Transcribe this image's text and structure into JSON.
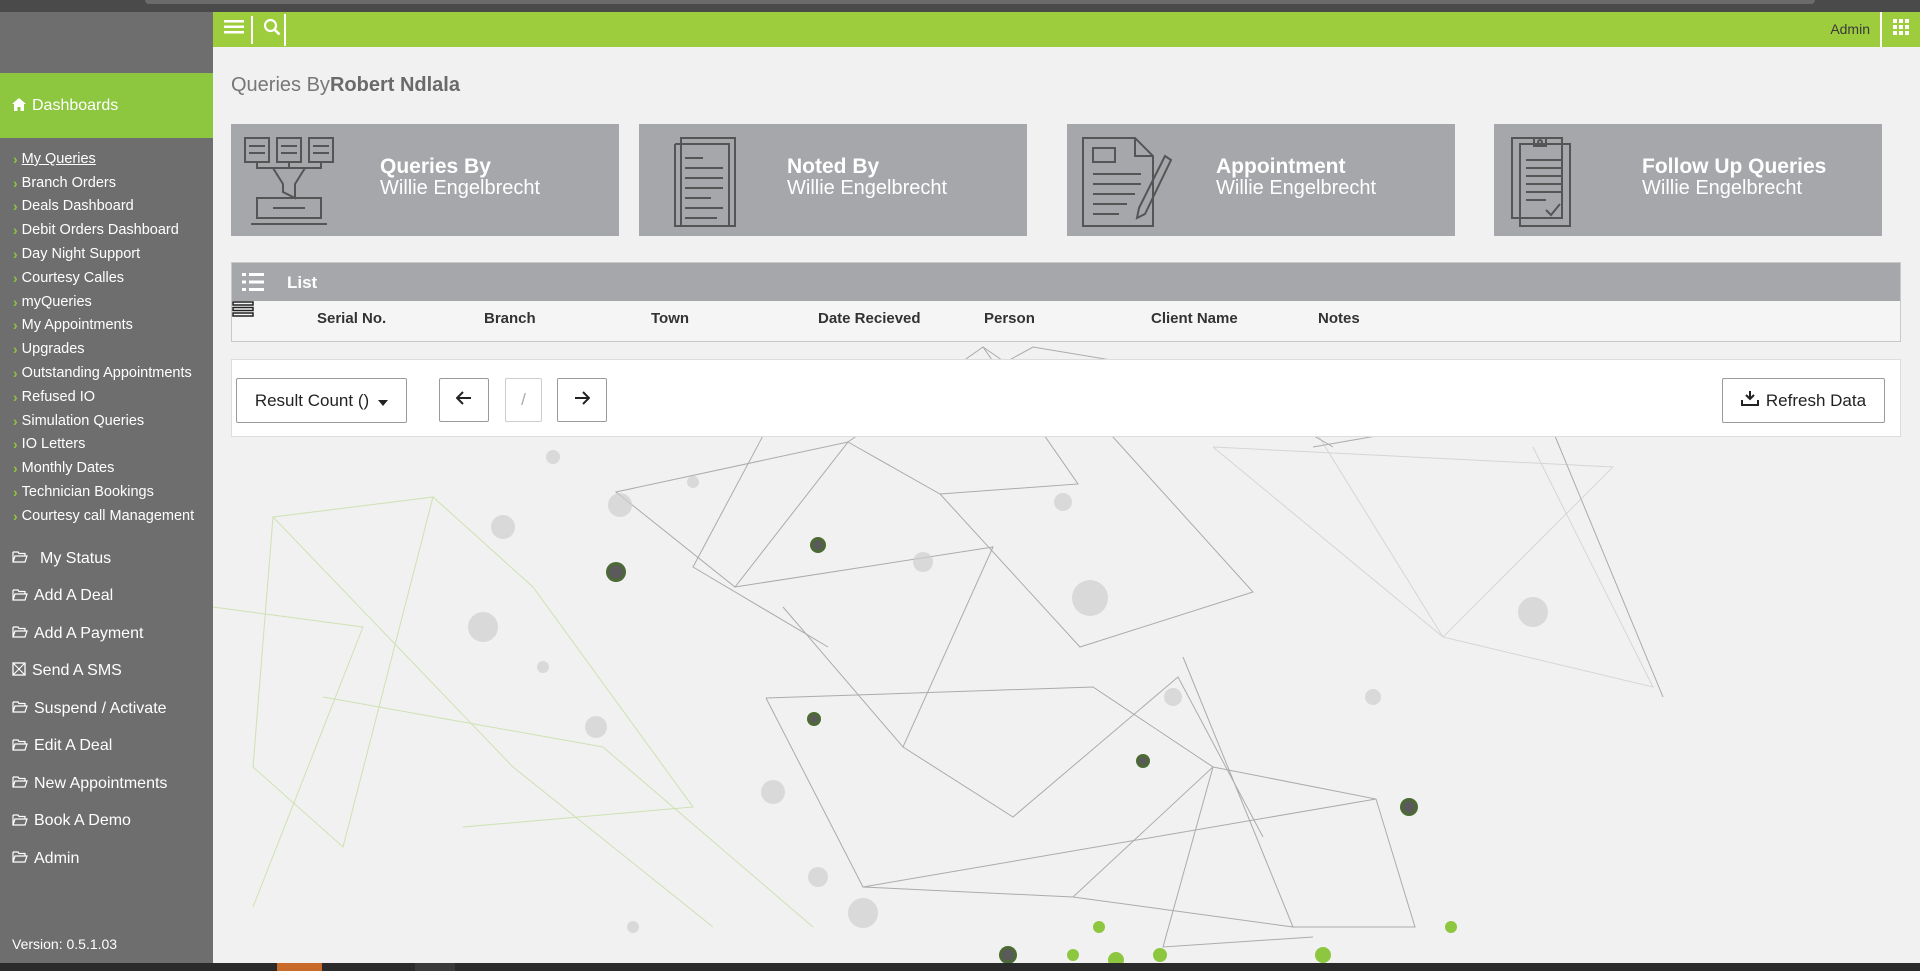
{
  "sidebar": {
    "dashboards_label": "Dashboards",
    "items": [
      {
        "label": "My Queries"
      },
      {
        "label": "Branch Orders"
      },
      {
        "label": "Deals Dashboard"
      },
      {
        "label": "Debit Orders Dashboard"
      },
      {
        "label": "Day Night Support"
      },
      {
        "label": "Courtesy Calles"
      },
      {
        "label": "myQueries"
      },
      {
        "label": "My Appointments"
      },
      {
        "label": "Upgrades"
      },
      {
        "label": "Outstanding Appointments"
      },
      {
        "label": "Refused IO"
      },
      {
        "label": "Simulation Queries"
      },
      {
        "label": "IO Letters"
      },
      {
        "label": "Monthly Dates"
      },
      {
        "label": "Technician Bookings"
      },
      {
        "label": "Courtesy call Management"
      }
    ],
    "menu": [
      {
        "label": "My Status"
      },
      {
        "label": "Add A Deal"
      },
      {
        "label": "Add A Payment"
      },
      {
        "label": "Send A SMS"
      },
      {
        "label": "Suspend / Activate"
      },
      {
        "label": "Edit A Deal"
      },
      {
        "label": "New Appointments"
      },
      {
        "label": "Book A Demo"
      },
      {
        "label": "Admin"
      }
    ],
    "version": "Version: 0.5.1.03"
  },
  "topbar": {
    "user": "Admin"
  },
  "page": {
    "title_prefix": "Queries By",
    "title_name": "Robert Ndlala"
  },
  "cards": [
    {
      "title": "Queries By",
      "name": "Willie Engelbrecht"
    },
    {
      "title": "Noted By",
      "name": "Willie Engelbrecht"
    },
    {
      "title": "Appointment",
      "name": "Willie Engelbrecht"
    },
    {
      "title": "Follow Up Queries",
      "name": "Willie Engelbrecht"
    }
  ],
  "list": {
    "title": "List",
    "columns": [
      "Serial No.",
      "Branch",
      "Town",
      "Date Recieved",
      "Person",
      "Client Name",
      "Notes"
    ]
  },
  "pager": {
    "result_count": "Result Count ()",
    "page_indicator": "/",
    "refresh": "Refresh Data"
  },
  "colors": {
    "accent_green": "#8dc63f",
    "topbar_green": "#9dcd3d",
    "sidebar_gray": "#6e6e6e",
    "card_gray": "#a6a7ab"
  }
}
